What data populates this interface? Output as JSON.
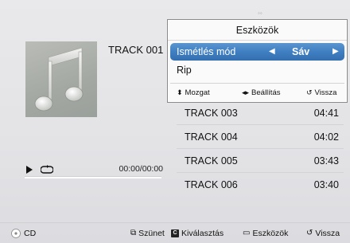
{
  "now_playing": {
    "track_title": "TRACK 001",
    "elapsed_time": "00:00/00:00",
    "progress": 0
  },
  "tools_popup": {
    "title": "Eszközök",
    "repeat_mode": {
      "label": "Ismétlés mód",
      "value": "Sáv"
    },
    "rip_label": "Rip",
    "hints": {
      "move": "Mozgat",
      "settings": "Beállítás",
      "back": "Vissza"
    }
  },
  "track_list": [
    {
      "name": "TRACK 003",
      "duration": "04:41"
    },
    {
      "name": "TRACK 004",
      "duration": "04:02"
    },
    {
      "name": "TRACK 005",
      "duration": "03:43"
    },
    {
      "name": "TRACK 006",
      "duration": "03:40"
    }
  ],
  "bottom_bar": {
    "source": "CD",
    "pause": "Szünet",
    "select": "Kiválasztás",
    "tools": "Eszközök",
    "back": "Vissza"
  },
  "colors": {
    "selection": "#3f7fc2",
    "progress": "#5aa6e6",
    "background": "#e5e5e8"
  }
}
